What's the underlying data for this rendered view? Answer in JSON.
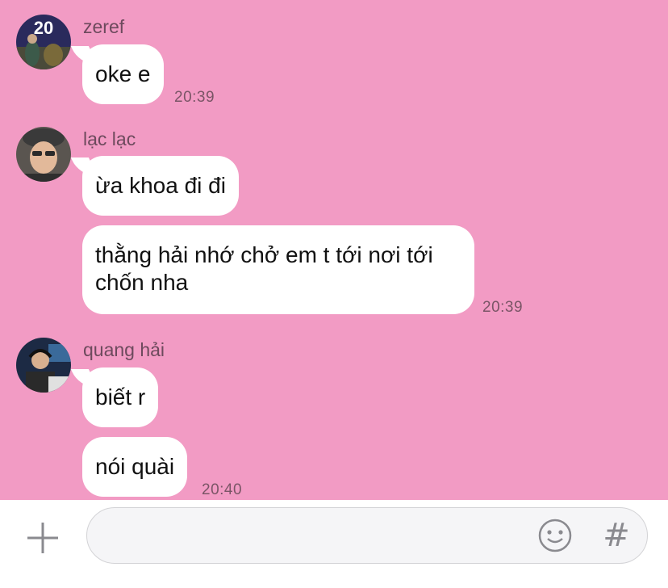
{
  "messages": [
    {
      "sender": "zeref",
      "avatar_icon": "avatar-zeref-icon",
      "bubbles": [
        "oke e"
      ],
      "time": "20:39"
    },
    {
      "sender": "lạc lạc",
      "avatar_icon": "avatar-lac-lac-icon",
      "bubbles": [
        "ừa khoa đi đi",
        "thằng hải nhớ chở em t tới nơi tới chốn nha"
      ],
      "time": "20:39"
    },
    {
      "sender": "quang hải",
      "avatar_icon": "avatar-quang-hai-icon",
      "bubbles": [
        "biết r",
        "nói quài"
      ],
      "time": "20:40"
    }
  ],
  "input_bar": {
    "plus_icon": "plus-icon",
    "placeholder": "",
    "emoji_icon": "emoji-icon",
    "hash_label": "#"
  },
  "colors": {
    "chat_background": "#f29bc4",
    "bubble": "#ffffff",
    "input_bar": "#ffffff",
    "icon_gray": "#8a8a8f"
  }
}
